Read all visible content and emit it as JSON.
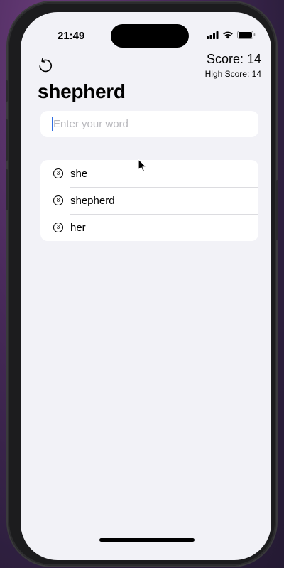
{
  "status_bar": {
    "time": "21:49"
  },
  "header": {
    "restart_icon": "restart-icon",
    "score_label": "Score: 14",
    "high_score_label": "High Score: 14"
  },
  "root_word": "shepherd",
  "input": {
    "placeholder": "Enter your word",
    "value": ""
  },
  "used_words": [
    {
      "letters": "3",
      "word": "she"
    },
    {
      "letters": "8",
      "word": "shepherd"
    },
    {
      "letters": "3",
      "word": "her"
    }
  ],
  "colors": {
    "background": "#f2f2f7",
    "card": "#ffffff",
    "caret": "#2f6de1",
    "placeholder": "#b8b8bd"
  }
}
